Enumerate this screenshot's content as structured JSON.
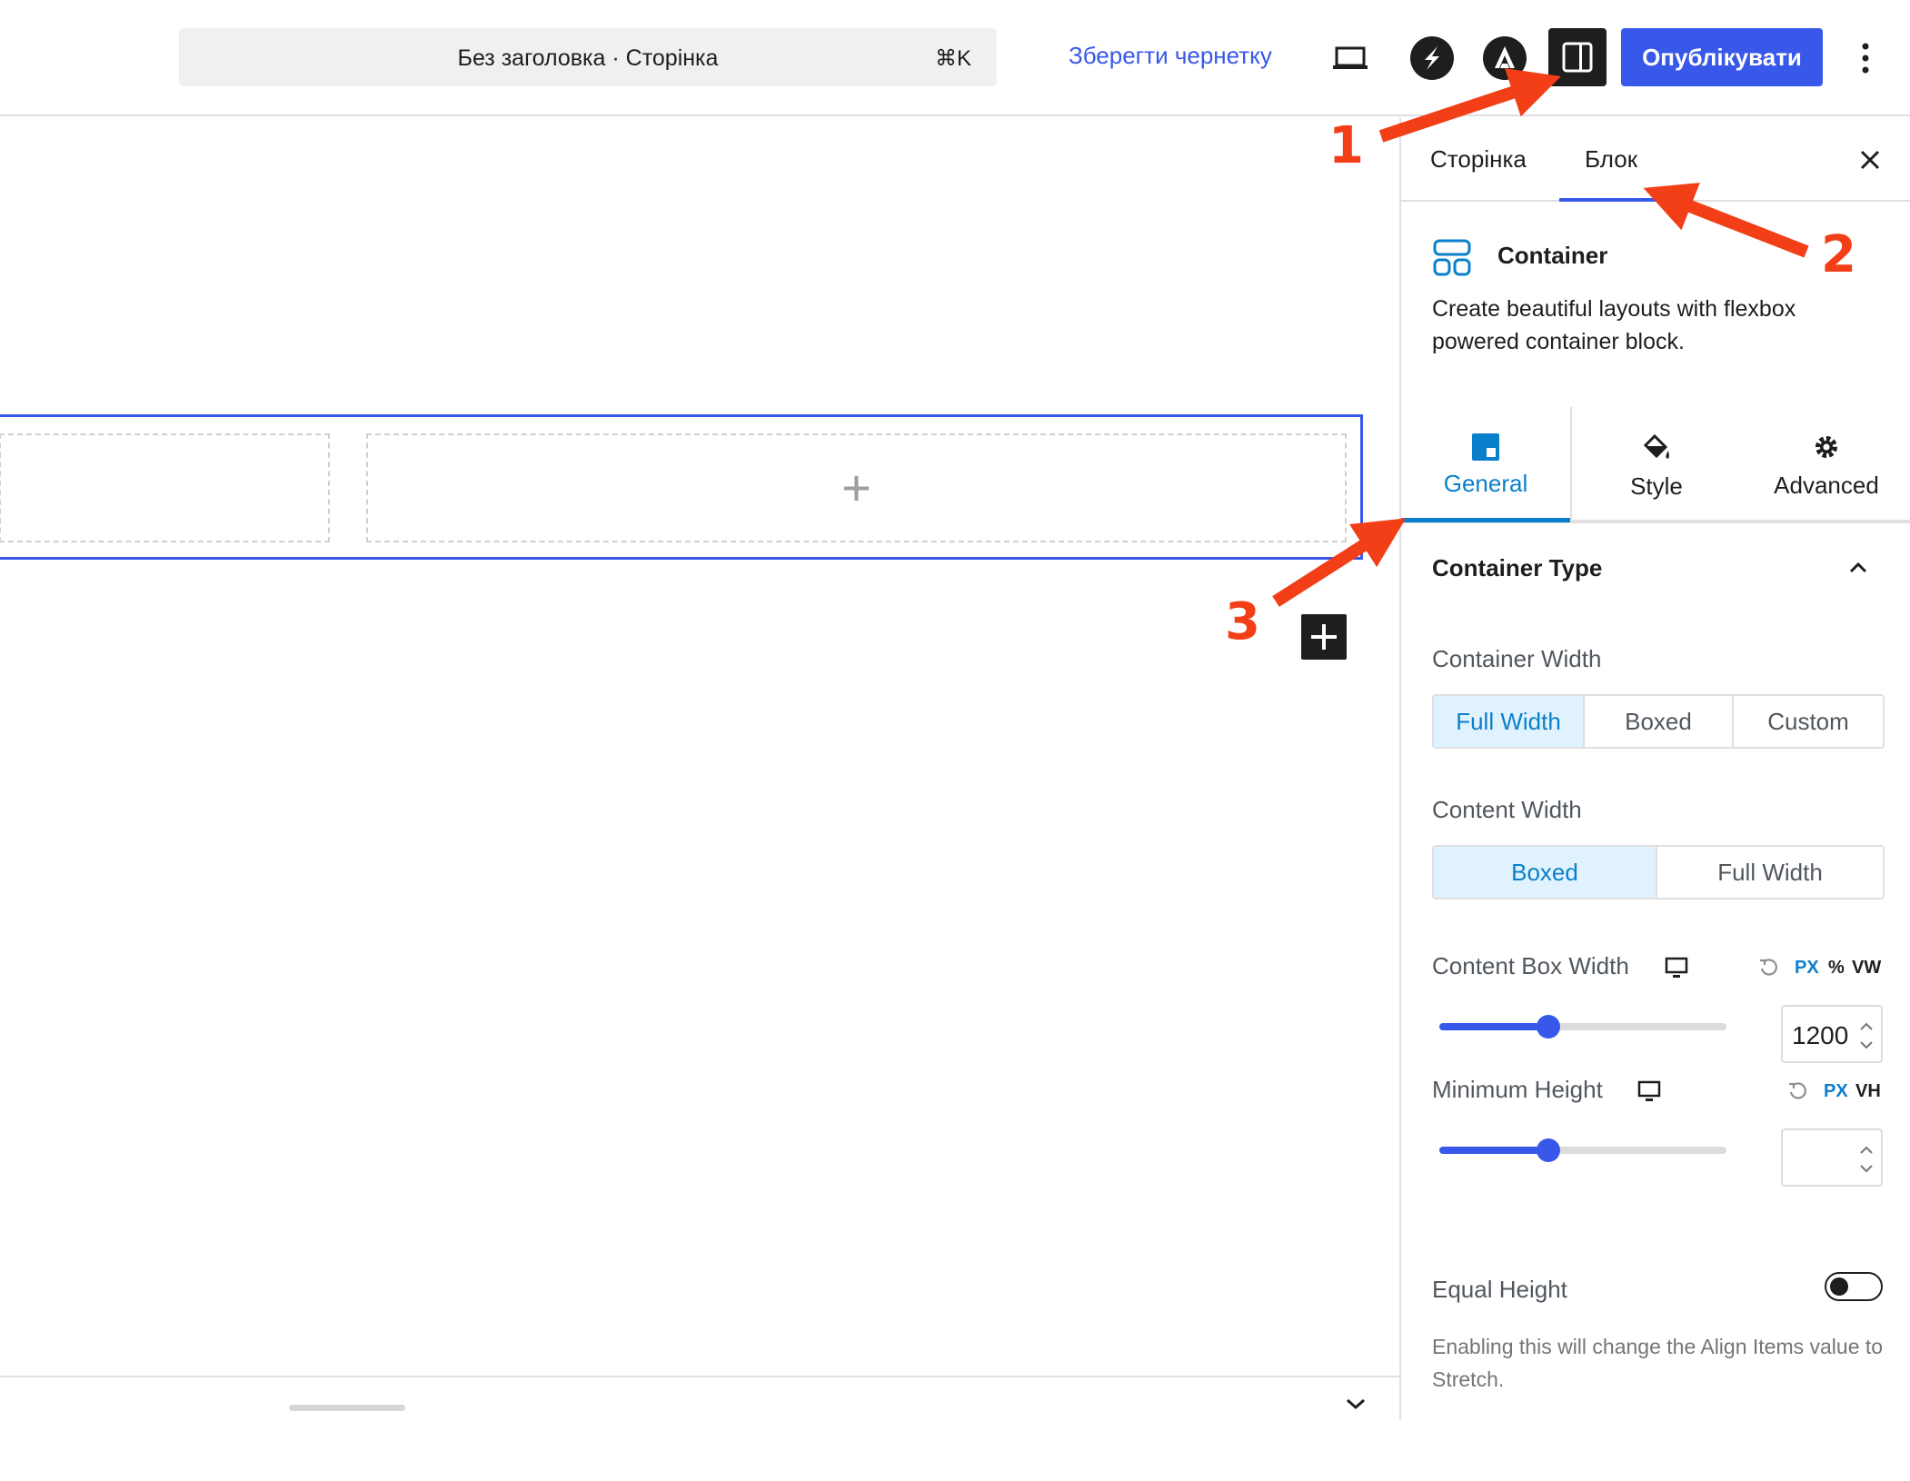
{
  "topbar": {
    "document_title": "Без заголовка · Сторінка",
    "shortcut": "⌘K",
    "save_draft_label": "Зберегти чернетку",
    "publish_label": "Опублікувати",
    "icons": [
      "laptop-preview-icon",
      "spectra-icon",
      "astra-icon",
      "sidebar-toggle-icon",
      "more-options-icon"
    ]
  },
  "sidebar": {
    "tabs": [
      "Сторінка",
      "Блок"
    ],
    "active_tab": "Блок",
    "block": {
      "name": "Container",
      "description": "Create beautiful layouts with flexbox powered container block."
    },
    "inspector_tabs": [
      "General",
      "Style",
      "Advanced"
    ],
    "active_inspector_tab": "General",
    "section": {
      "title": "Container Type",
      "container_width": {
        "label": "Container Width",
        "options": [
          "Full Width",
          "Boxed",
          "Custom"
        ],
        "selected": "Full Width"
      },
      "content_width": {
        "label": "Content Width",
        "options": [
          "Boxed",
          "Full Width"
        ],
        "selected": "Boxed"
      },
      "content_box_width": {
        "label": "Content Box Width",
        "units": [
          "PX",
          "%",
          "VW"
        ],
        "active_unit": "PX",
        "value": "1200",
        "slider_fraction": 0.38
      },
      "minimum_height": {
        "label": "Minimum Height",
        "units": [
          "PX",
          "VH"
        ],
        "active_unit": "PX",
        "value": "",
        "slider_fraction": 0.38
      },
      "equal_height": {
        "label": "Equal Height",
        "enabled": false,
        "help": "Enabling this will change the Align Items value to Stretch."
      }
    }
  },
  "annotations": [
    "1",
    "2",
    "3"
  ],
  "colors": {
    "accent": "#3858e9",
    "inspector_accent": "#0a7fcb",
    "annotation": "#f23f17"
  }
}
